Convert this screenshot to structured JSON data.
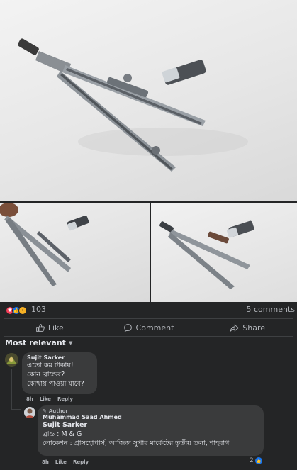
{
  "post": {
    "reaction_count": "103",
    "comments_count": "5 comments",
    "reactions": [
      "love-icon",
      "like-icon",
      "wow-icon"
    ]
  },
  "actions": {
    "like": "Like",
    "comment": "Comment",
    "share": "Share"
  },
  "sort": {
    "label": "Most relevant"
  },
  "comments": [
    {
      "author": "Sujit Sarker",
      "lines": [
        "এতো কম টাকায়!",
        "কোন ব্রান্ডের?",
        "কোথায় পাওয়া যাবে?"
      ],
      "time": "8h",
      "like": "Like",
      "reply": "Reply"
    }
  ],
  "reply": {
    "badge": "Author",
    "author": "Muhammad Saad Ahmed",
    "mention": "Sujit Sarker",
    "lines": [
      "ব্রান্ড : M & G",
      "লোকেশন : গ্রাসহোপার্স, আজিজ সুপার মার্কেটের তৃতীয় তলা, শাহবাগ"
    ],
    "time": "8h",
    "like": "Like",
    "reply": "Reply",
    "likes": "2"
  },
  "colors": {
    "background": "#242526",
    "bubble": "#3a3b3c",
    "text": "#e4e6eb",
    "muted": "#b0b3b8",
    "like_blue": "#1877f2",
    "love_red": "#f33e58",
    "wow_yellow": "#f7b125"
  }
}
